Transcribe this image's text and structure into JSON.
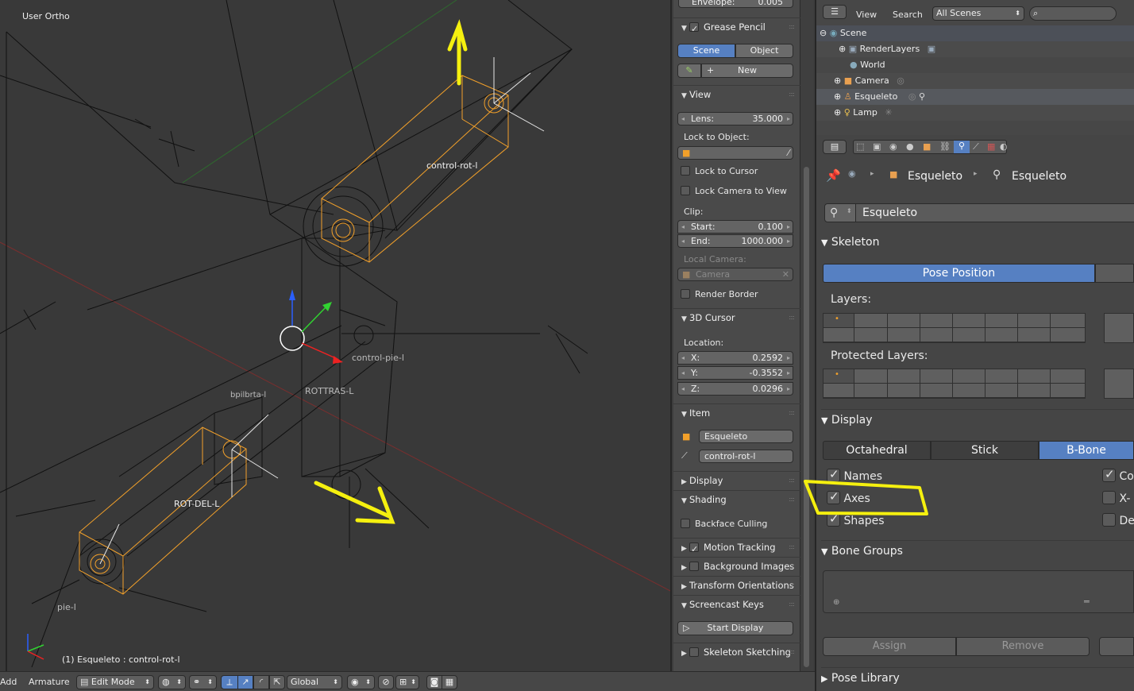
{
  "viewport": {
    "view_name": "User Ortho",
    "status_text": "(1) Esqueleto : control-rot-l",
    "bone_labels": [
      "control-rot-l",
      "control-pie-l",
      "ROTTRAS-L",
      "ROT-DEL-L",
      "pie-l",
      "bpilbrta-l"
    ]
  },
  "npanel": {
    "envelope_label": "Envelope:",
    "envelope_value": "0.005",
    "grease_pencil": {
      "title": "Grease Pencil",
      "scene_tab": "Scene",
      "object_tab": "Object",
      "new_label": "New"
    },
    "view": {
      "title": "View",
      "lens_label": "Lens:",
      "lens_value": "35.000",
      "lock_to_object_label": "Lock to Object:",
      "lock_to_cursor": "Lock to Cursor",
      "lock_camera_to_view": "Lock Camera to View",
      "clip_label": "Clip:",
      "start_label": "Start:",
      "start_value": "0.100",
      "end_label": "End:",
      "end_value": "1000.000",
      "local_camera_label": "Local Camera:",
      "camera_field": "Camera",
      "render_border": "Render Border"
    },
    "cursor": {
      "title": "3D Cursor",
      "location_label": "Location:",
      "x_label": "X:",
      "x_value": "0.2592",
      "y_label": "Y:",
      "y_value": "-0.3552",
      "z_label": "Z:",
      "z_value": "0.0296"
    },
    "item": {
      "title": "Item",
      "object_name": "Esqueleto",
      "bone_name": "control-rot-l"
    },
    "display_title": "Display",
    "shading": {
      "title": "Shading",
      "backface_culling": "Backface Culling"
    },
    "motion_tracking": "Motion Tracking",
    "background_images": "Background Images",
    "transform_orientations": "Transform Orientations",
    "screencast": {
      "title": "Screencast Keys",
      "start_display": "Start Display"
    },
    "skeleton_sketching": "Skeleton Sketching"
  },
  "outliner": {
    "view_menu": "View",
    "search_menu": "Search",
    "scenes_dropdown": "All Scenes",
    "rows": [
      "Scene",
      "RenderLayers",
      "World",
      "Camera",
      "Esqueleto",
      "Lamp"
    ]
  },
  "properties": {
    "breadcrumb_object": "Esqueleto",
    "breadcrumb_armature": "Esqueleto",
    "datablock_name": "Esqueleto",
    "skeleton": {
      "title": "Skeleton",
      "pose_position": "Pose Position",
      "layers_label": "Layers:",
      "protected_layers_label": "Protected Layers:"
    },
    "display": {
      "title": "Display",
      "octahedral": "Octahedral",
      "stick": "Stick",
      "bbone": "B-Bone",
      "names": "Names",
      "axes": "Axes",
      "shapes": "Shapes",
      "right_col": [
        "Co",
        "X-",
        "De"
      ]
    },
    "bone_groups": {
      "title": "Bone Groups",
      "assign": "Assign",
      "remove": "Remove"
    },
    "pose_library": "Pose Library"
  },
  "bottombar": {
    "add_menu": "Add",
    "armature_menu": "Armature",
    "mode": "Edit Mode",
    "orientation": "Global"
  },
  "colors": {
    "annotation_yellow": "#f5f00f",
    "selection_blue": "#5680c2",
    "bone_orange": "#f2a02a"
  }
}
